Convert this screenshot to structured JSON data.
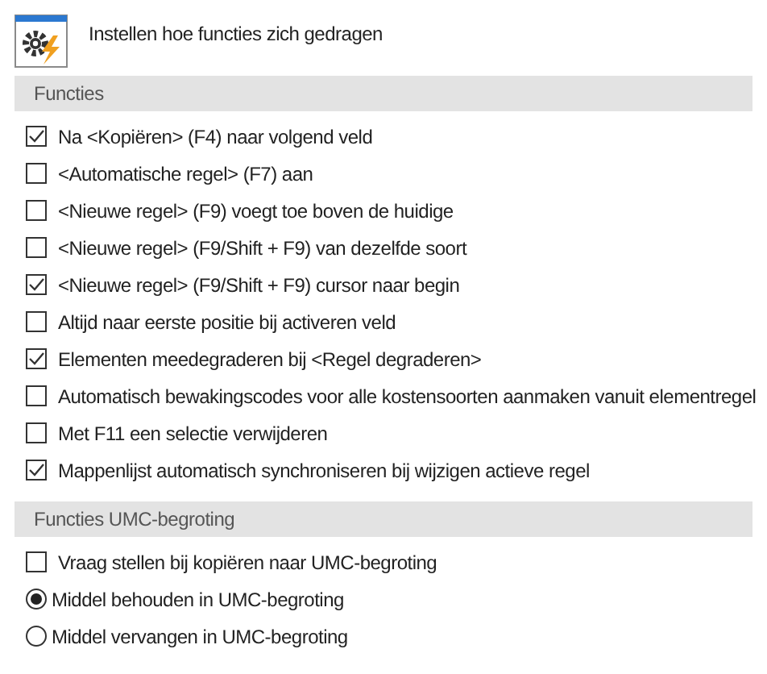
{
  "header": {
    "title": "Instellen hoe functies zich gedragen"
  },
  "sections": [
    {
      "title": "Functies",
      "items": [
        {
          "kind": "checkbox",
          "label": "Na <Kopiëren> (F4) naar volgend veld",
          "checked": true
        },
        {
          "kind": "checkbox",
          "label": "<Automatische regel> (F7) aan",
          "checked": false
        },
        {
          "kind": "checkbox",
          "label": "<Nieuwe regel> (F9) voegt toe boven de huidige",
          "checked": false
        },
        {
          "kind": "checkbox",
          "label": "<Nieuwe regel> (F9/Shift + F9) van dezelfde soort",
          "checked": false
        },
        {
          "kind": "checkbox",
          "label": "<Nieuwe regel> (F9/Shift + F9) cursor naar begin",
          "checked": true
        },
        {
          "kind": "checkbox",
          "label": "Altijd naar eerste positie bij activeren veld",
          "checked": false
        },
        {
          "kind": "checkbox",
          "label": "Elementen meedegraderen bij <Regel degraderen>",
          "checked": true
        },
        {
          "kind": "checkbox",
          "label": "Automatisch bewakingscodes voor alle kostensoorten aanmaken vanuit elementregel",
          "checked": false
        },
        {
          "kind": "checkbox",
          "label": "Met F11 een selectie verwijderen",
          "checked": false
        },
        {
          "kind": "checkbox",
          "label": "Mappenlijst automatisch synchroniseren bij wijzigen actieve regel",
          "checked": true
        }
      ]
    },
    {
      "title": "Functies UMC-begroting",
      "items": [
        {
          "kind": "checkbox",
          "label": "Vraag stellen bij kopiëren naar UMC-begroting",
          "checked": false
        },
        {
          "kind": "radio",
          "label": "Middel behouden in UMC-begroting",
          "selected": true
        },
        {
          "kind": "radio",
          "label": "Middel vervangen in UMC-begroting",
          "selected": false
        }
      ]
    }
  ]
}
